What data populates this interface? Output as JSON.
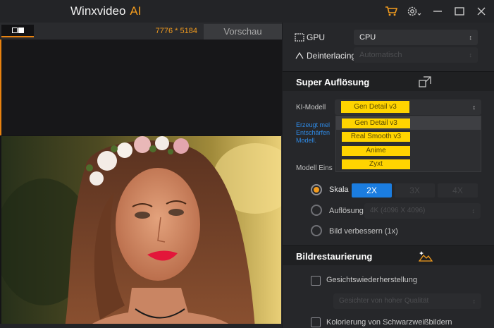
{
  "app": {
    "title": "Winxvideo",
    "title_suffix": "AI"
  },
  "titlebar_icons": [
    "cart-icon",
    "gear-icon",
    "minimize-icon",
    "maximize-icon",
    "close-icon"
  ],
  "preview": {
    "resolution": "7776 * 5184",
    "tab": "Vorschau"
  },
  "panel": {
    "gpu_label": "GPU",
    "gpu_value": "CPU",
    "deinterlacing_label": "Deinterlacing",
    "deinterlacing_value": "Automatisch",
    "super": {
      "title": "Super Auflösung",
      "model_label": "KI-Modell",
      "model_value": "Gen Detail v3",
      "desc_line1": "Erzeugt mel",
      "desc_line2": "Entschärfen",
      "desc_line3": "Modell.",
      "settings_label": "Modell Eins",
      "scale_label": "Skala",
      "scale_options": [
        "2X",
        "3X",
        "4X"
      ],
      "resolution_label": "Auflösung",
      "resolution_value": "4K (4096 X 4096)",
      "enhance_label": "Bild verbessern (1x)",
      "dropdown": [
        "Gen Detail v3",
        "Real Smooth v3",
        "Anime",
        "Zyxt"
      ]
    },
    "restore": {
      "title": "Bildrestaurierung",
      "face_label": "Gesichtswiederherstellung",
      "face_value": "Gesichter von hoher Qualität",
      "color_label": "Kolorierung von Schwarzweißbildern"
    }
  },
  "colors": {
    "accent": "#f39c1e",
    "blue": "#1b7de0",
    "highlight": "#ffd400"
  }
}
